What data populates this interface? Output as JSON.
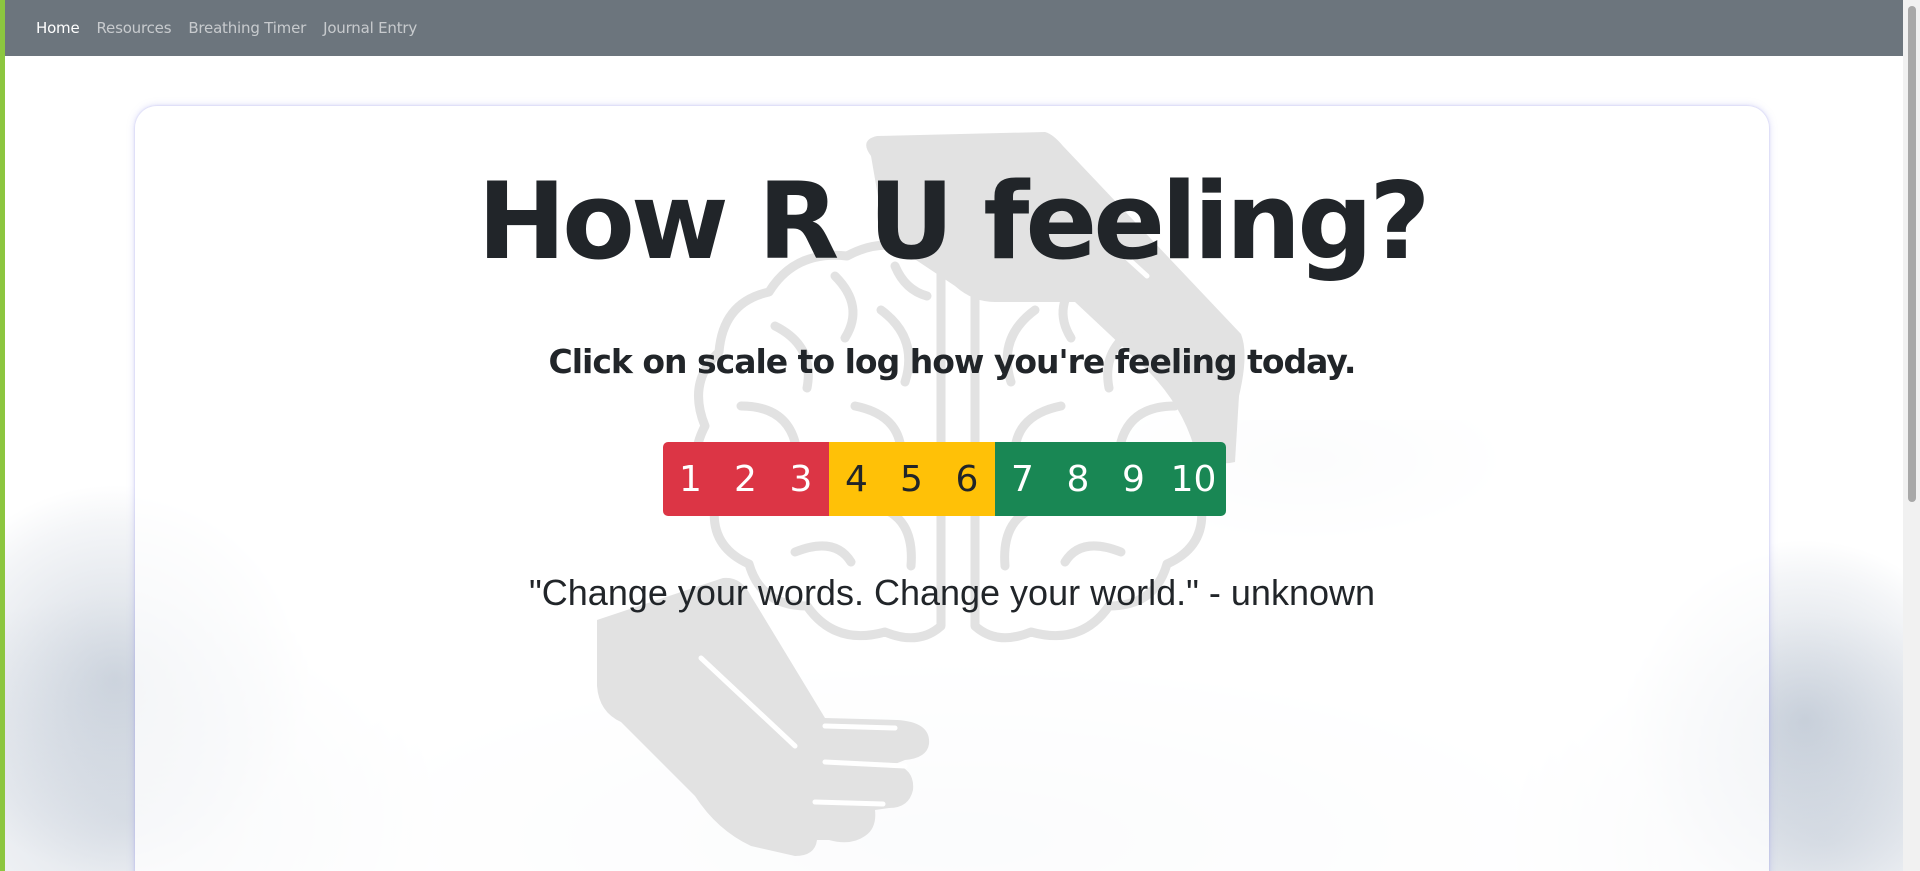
{
  "navbar": {
    "links": [
      {
        "label": "Home",
        "active": true
      },
      {
        "label": "Resources",
        "active": false
      },
      {
        "label": "Breathing Timer",
        "active": false
      },
      {
        "label": "Journal Entry",
        "active": false
      }
    ]
  },
  "main": {
    "title": "How R U feeling?",
    "instruction": "Click on scale to log how you're feeling today.",
    "quote": "\"Change your words. Change your world.\" - unknown"
  },
  "mood_scale": {
    "buttons": [
      {
        "label": "1",
        "color": "#dc3545",
        "text_color": "#ffffff"
      },
      {
        "label": "2",
        "color": "#dc3545",
        "text_color": "#ffffff"
      },
      {
        "label": "3",
        "color": "#dc3545",
        "text_color": "#ffffff"
      },
      {
        "label": "4",
        "color": "#ffc107",
        "text_color": "#212529"
      },
      {
        "label": "5",
        "color": "#ffc107",
        "text_color": "#212529"
      },
      {
        "label": "6",
        "color": "#ffc107",
        "text_color": "#212529"
      },
      {
        "label": "7",
        "color": "#198754",
        "text_color": "#ffffff"
      },
      {
        "label": "8",
        "color": "#198754",
        "text_color": "#ffffff"
      },
      {
        "label": "9",
        "color": "#198754",
        "text_color": "#ffffff"
      },
      {
        "label": "10",
        "color": "#198754",
        "text_color": "#ffffff"
      }
    ]
  },
  "colors": {
    "navbar_bg": "#6c757d",
    "accent_strip": "#8cc63f",
    "text_dark": "#212529",
    "illustration_gray": "#e2e2e2"
  },
  "icons": {
    "background_illustration": "brain-held-by-hands-icon"
  }
}
